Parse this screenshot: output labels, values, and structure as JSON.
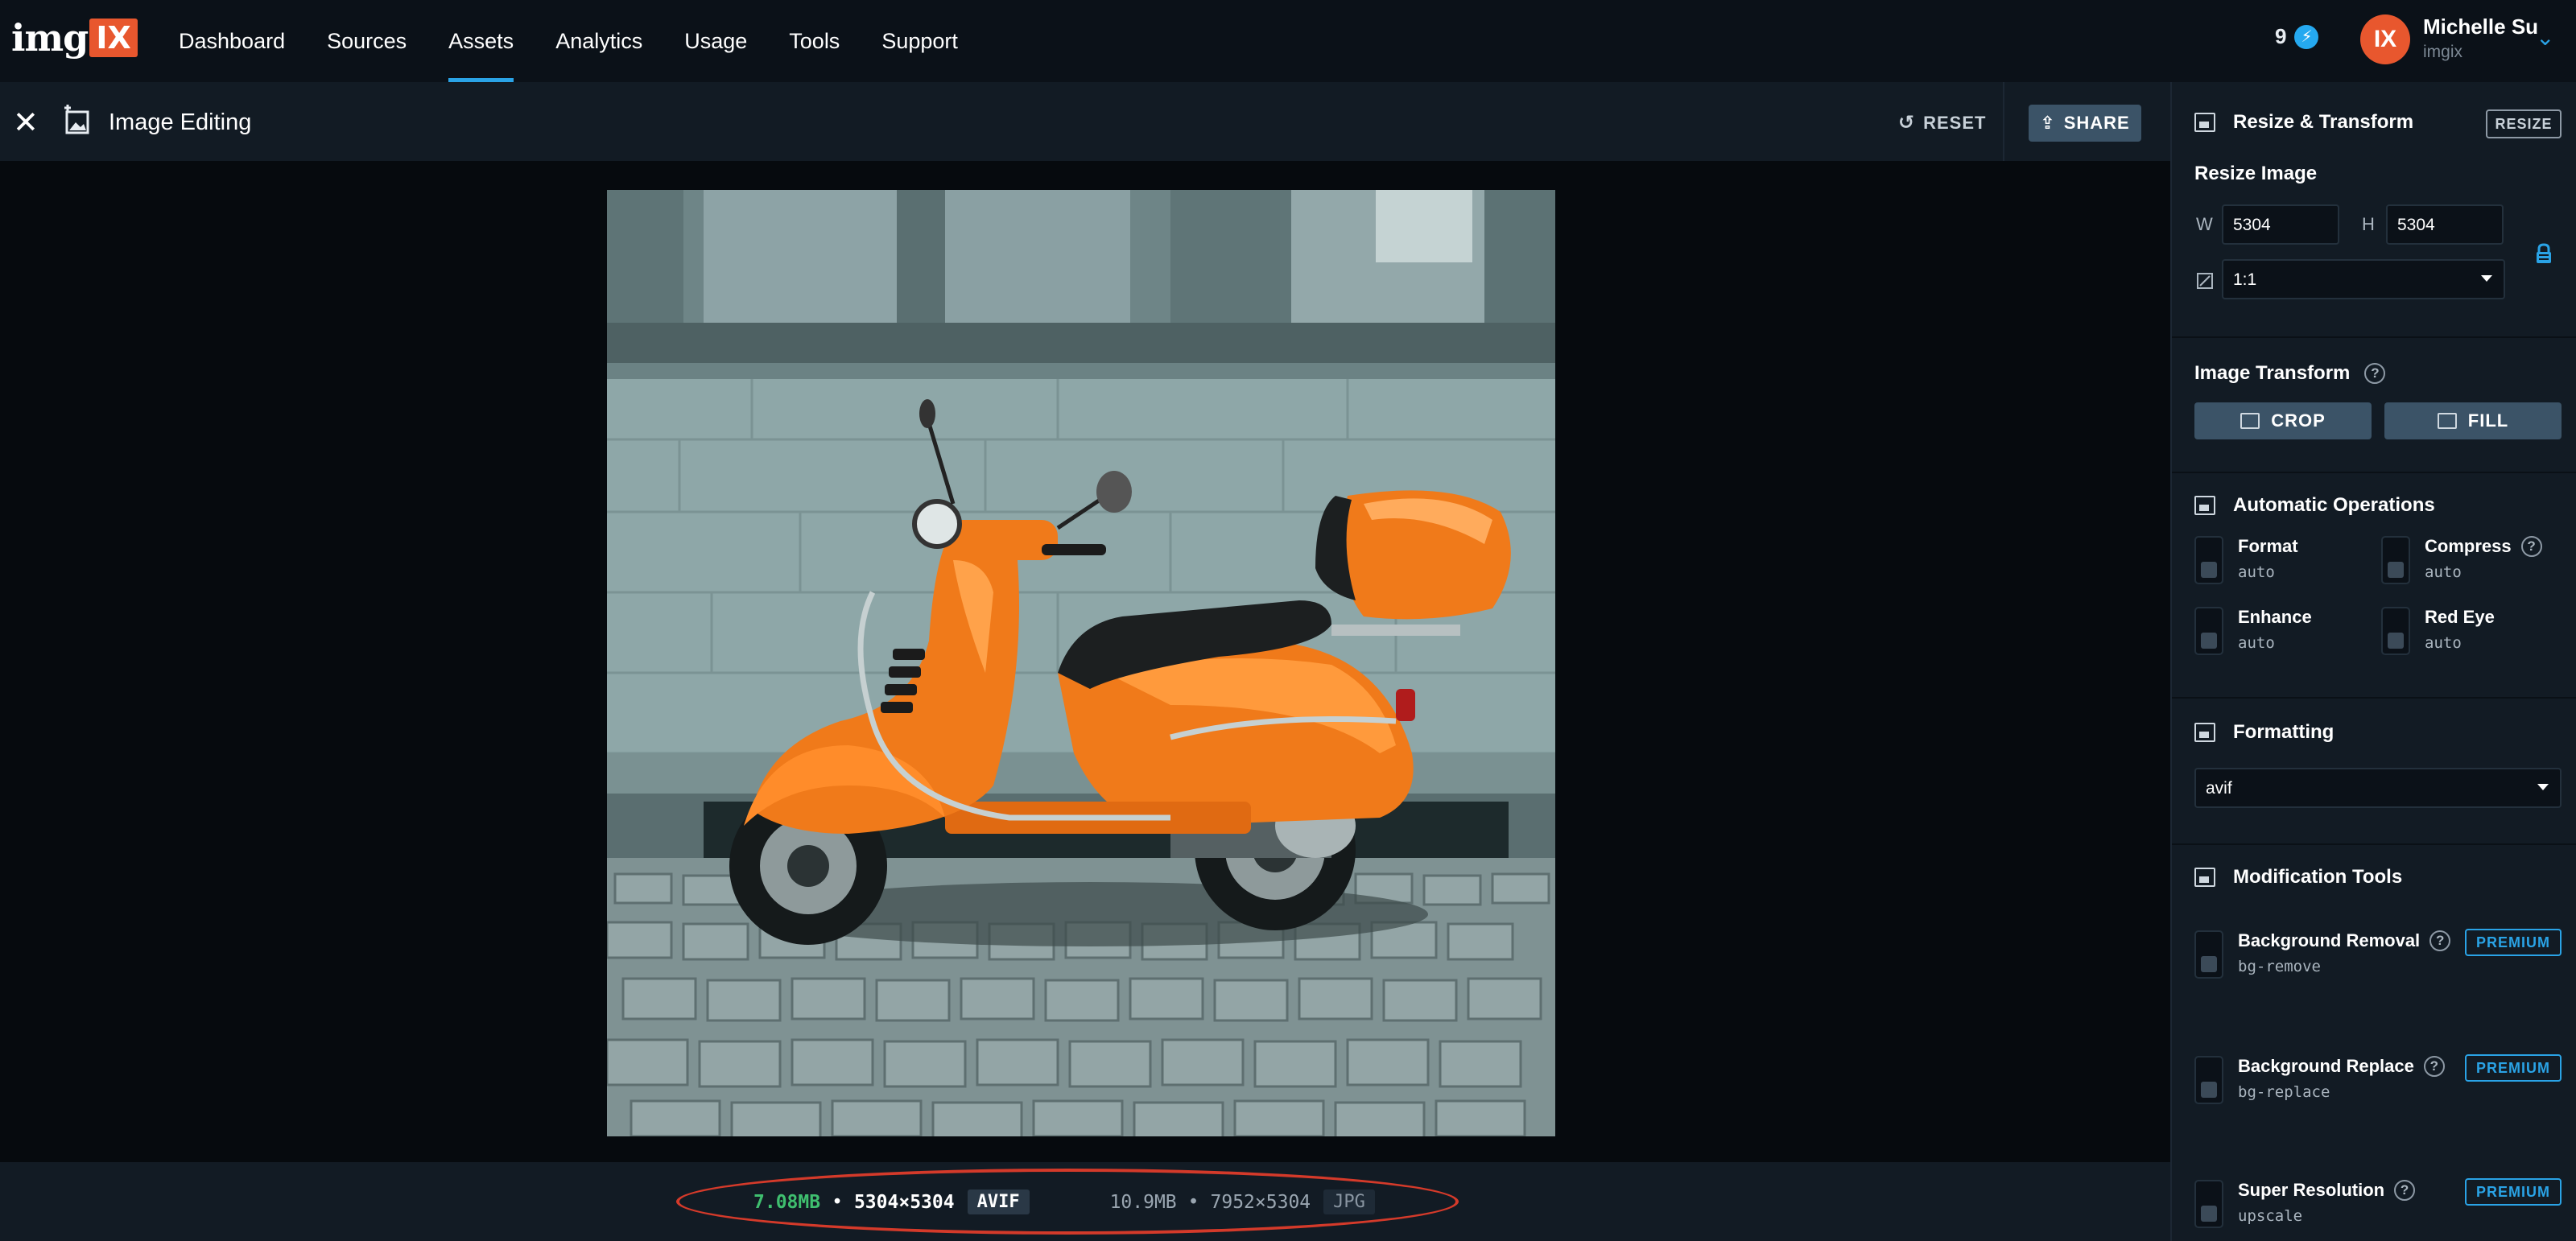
{
  "brand": {
    "word": "img",
    "box": "IX"
  },
  "nav": {
    "items": [
      "Dashboard",
      "Sources",
      "Assets",
      "Analytics",
      "Usage",
      "Tools",
      "Support"
    ],
    "active": "Assets"
  },
  "account": {
    "credits": "9",
    "avatar_initials": "IX",
    "name": "Michelle Su",
    "org": "imgix"
  },
  "toolbar": {
    "title": "Image Editing",
    "reset_label": "RESET",
    "share_label": "SHARE"
  },
  "image": {
    "subject": "orange scooter"
  },
  "status": {
    "new_size": "7.08MB",
    "new_dims": "5304×5304",
    "new_format": "AVIF",
    "orig_size": "10.9MB",
    "orig_dims": "7952×5304",
    "orig_format": "JPG"
  },
  "panel": {
    "resize": {
      "title": "Resize & Transform",
      "button": "RESIZE",
      "subtitle": "Resize Image",
      "w_label": "W",
      "w_value": "5304",
      "h_label": "H",
      "h_value": "5304",
      "ratio": "1:1"
    },
    "transform": {
      "title": "Image Transform",
      "crop": "CROP",
      "fill": "FILL"
    },
    "auto_ops": {
      "title": "Automatic Operations",
      "items": [
        {
          "name": "Format",
          "value": "auto"
        },
        {
          "name": "Compress",
          "value": "auto"
        },
        {
          "name": "Enhance",
          "value": "auto"
        },
        {
          "name": "Red Eye",
          "value": "auto"
        }
      ]
    },
    "formatting": {
      "title": "Formatting",
      "value": "avif"
    },
    "mod_tools": {
      "title": "Modification Tools",
      "items": [
        {
          "name": "Background Removal",
          "value": "bg-remove",
          "badge": "PREMIUM"
        },
        {
          "name": "Background Replace",
          "value": "bg-replace",
          "badge": "PREMIUM"
        },
        {
          "name": "Super Resolution",
          "value": "upscale",
          "badge": "PREMIUM"
        }
      ]
    }
  },
  "colors": {
    "accent": "#2aa3e6",
    "brand": "#e8572e",
    "size_green": "#3fbf6f",
    "highlight_red": "#d43a2a"
  }
}
